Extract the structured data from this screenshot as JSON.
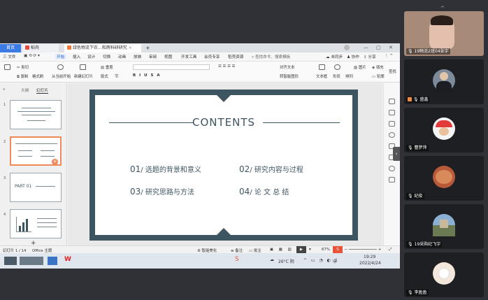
{
  "tabs": {
    "home": "首页",
    "daoke": "稻壳",
    "doc": "绿色物流下农...和两科研研究"
  },
  "menu": {
    "file": "三 文件",
    "start": "开始",
    "insert": "插入",
    "design": "设计",
    "switch": "切换",
    "animation": "动画",
    "slideshow": "放映",
    "review": "审阅",
    "view": "视图",
    "devtools": "开发工具",
    "member": "会员专享",
    "resources": "稻壳资源",
    "search": "查找命令、搜索模板",
    "unsync": "未同步",
    "collab": "协作",
    "share": "分享"
  },
  "ribbon": {
    "cut": "剪切",
    "copy": "复制",
    "format_painter": "格式刷",
    "from_start": "从当前开始",
    "new_slide": "新建幻灯片",
    "layout": "版式",
    "section": "节",
    "reset": "重置",
    "align_text": "对齐文本",
    "smart_art": "转智能图形",
    "textbox": "文本框",
    "shape": "形状",
    "arrange": "排列",
    "image": "图片",
    "fill": "填充",
    "outline": "轮廓",
    "find": "查找"
  },
  "leftpanel": {
    "outline_tab": "大纲",
    "slides_tab": "幻灯片",
    "thumb_nums": [
      "1",
      "2",
      "3",
      "4"
    ],
    "thumb3_text": "PART 01"
  },
  "slide": {
    "title": "CONTENTS",
    "items": [
      {
        "num": "01",
        "text": "选题的背景和意义"
      },
      {
        "num": "02",
        "text": "研究内容与过程"
      },
      {
        "num": "03",
        "text": "研究思路与方法"
      },
      {
        "num": "04",
        "text": "论 文 总 结"
      }
    ]
  },
  "status": {
    "slide_count": "幻灯片 1 / 14",
    "theme": "Office 主题",
    "beautify": "智能美化",
    "notes": "备注",
    "comments": "批注",
    "zoom": "67%"
  },
  "taskbar": {
    "ime": "中",
    "weather": "26°C 阴",
    "time": "19:29",
    "date": "2022/4/24"
  },
  "participants": [
    {
      "name": "19物流2班04张宇"
    },
    {
      "name": "盛鑫"
    },
    {
      "name": "曹梦萍"
    },
    {
      "name": "纪俊"
    },
    {
      "name": "19采购纪飞宇"
    },
    {
      "name": "李盈盈"
    }
  ],
  "colors": {
    "slide_accent": "#3d5561",
    "tab_active": "#3c7ae6",
    "selected_thumb": "#f08a5d"
  }
}
